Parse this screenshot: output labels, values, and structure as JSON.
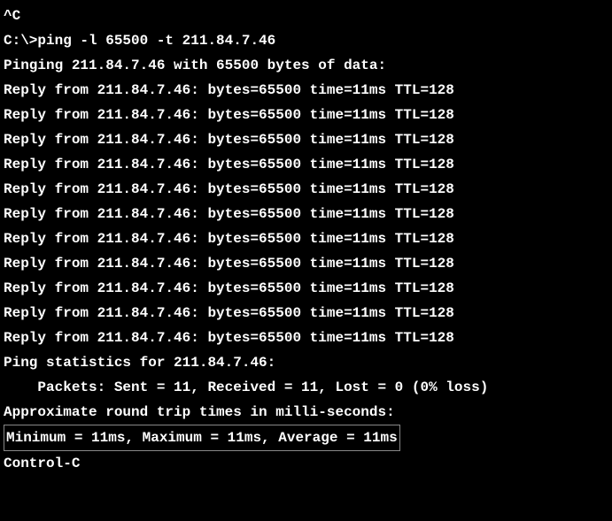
{
  "interrupt": "^C",
  "prompt": "C:\\>ping -l 65500 -t 211.84.7.46",
  "blank1": "",
  "header": "Pinging 211.84.7.46 with 65500 bytes of data:",
  "blank2": "",
  "replies": [
    "Reply from 211.84.7.46: bytes=65500 time=11ms TTL=128",
    "Reply from 211.84.7.46: bytes=65500 time=11ms TTL=128",
    "Reply from 211.84.7.46: bytes=65500 time=11ms TTL=128",
    "Reply from 211.84.7.46: bytes=65500 time=11ms TTL=128",
    "Reply from 211.84.7.46: bytes=65500 time=11ms TTL=128",
    "Reply from 211.84.7.46: bytes=65500 time=11ms TTL=128",
    "Reply from 211.84.7.46: bytes=65500 time=11ms TTL=128",
    "Reply from 211.84.7.46: bytes=65500 time=11ms TTL=128",
    "Reply from 211.84.7.46: bytes=65500 time=11ms TTL=128",
    "Reply from 211.84.7.46: bytes=65500 time=11ms TTL=128",
    "Reply from 211.84.7.46: bytes=65500 time=11ms TTL=128"
  ],
  "blank3": "",
  "stats_header": "Ping statistics for 211.84.7.46:",
  "packets": "    Packets: Sent = 11, Received = 11, Lost = 0 (0% loss)",
  "approx": "Approximate round trip times in milli-seconds:",
  "timing": "    Minimum = 11ms, Maximum = 11ms, Average = 11ms",
  "ctrl": "Control-C"
}
